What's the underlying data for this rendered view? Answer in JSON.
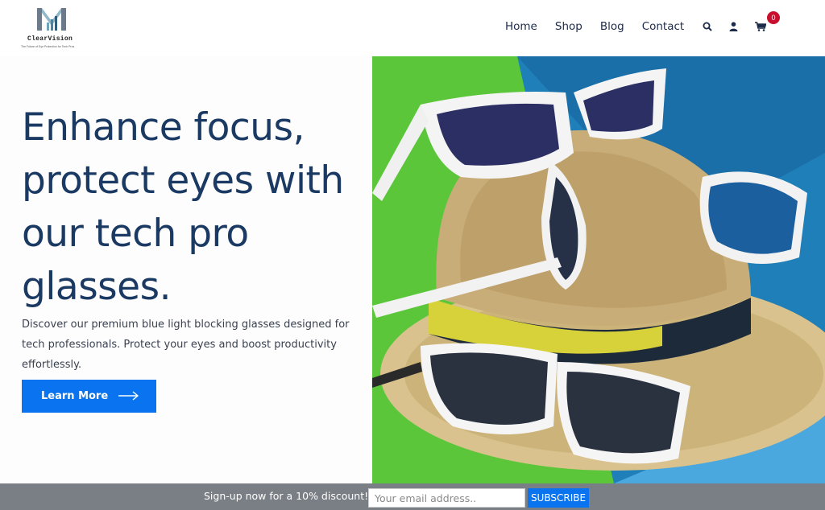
{
  "brand": {
    "name": "ClearVision",
    "tagline": "The Future of Eye Protection for Tech Pros"
  },
  "nav": {
    "items": [
      {
        "label": "Home"
      },
      {
        "label": "Shop"
      },
      {
        "label": "Blog"
      },
      {
        "label": "Contact"
      }
    ]
  },
  "header_icons": {
    "search": "search-icon",
    "account": "user-icon",
    "cart": "cart-icon",
    "cart_count": "0"
  },
  "hero": {
    "title": "Enhance focus, protect eyes with our tech pro glasses.",
    "description": "Discover our premium blue light blocking glasses designed for tech professionals. Protect your eyes and boost productivity effortlessly.",
    "button_label": "Learn More",
    "button_icon": "arrow-right-icon"
  },
  "signup": {
    "text": "Sign-up now for a 10% discount!!",
    "email_placeholder": "Your email address..",
    "button_label": "SUBSCRIBE"
  },
  "colors": {
    "accent": "#0a74f0",
    "heading": "#1b3a63",
    "badge": "#c8102e",
    "footer_bar": "#7a7e85"
  }
}
